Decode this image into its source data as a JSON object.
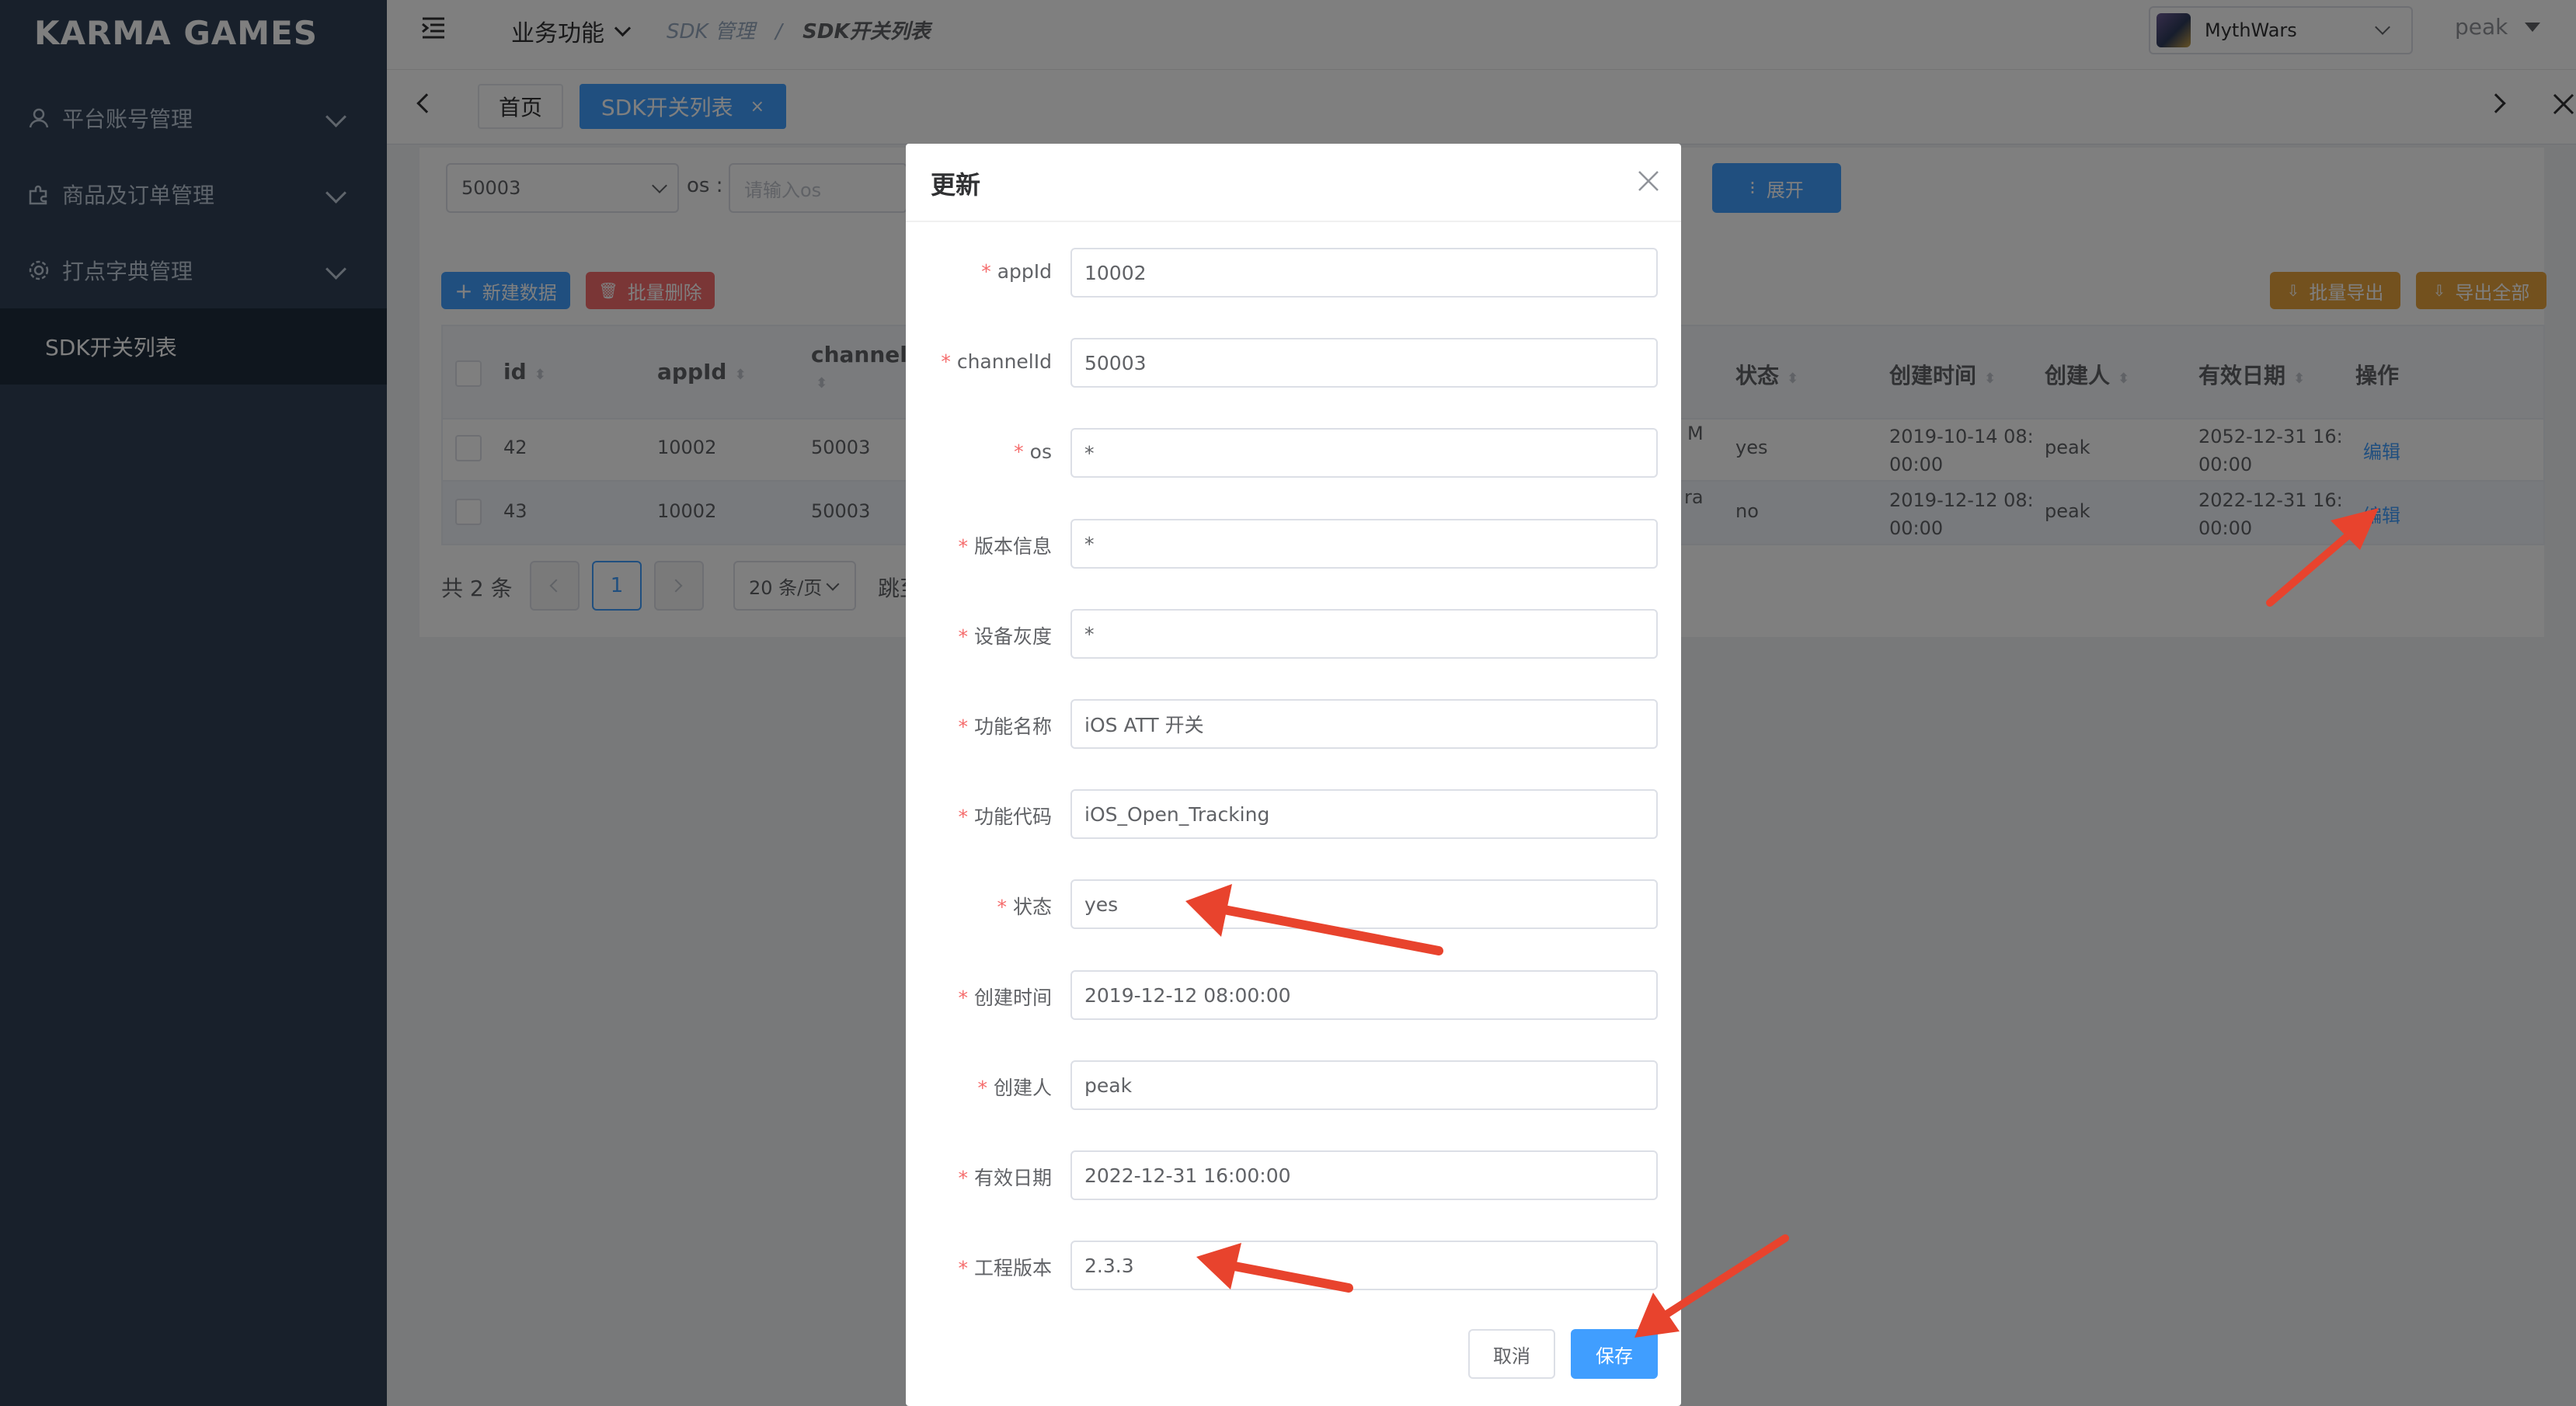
{
  "sidebar": {
    "logo": "KARMA GAMES",
    "items": [
      {
        "label": "平台账号管理",
        "icon": "user-icon"
      },
      {
        "label": "商品及订单管理",
        "icon": "puzzle-icon"
      },
      {
        "label": "打点字典管理",
        "icon": "gear-icon"
      }
    ],
    "active_item": "SDK开关列表"
  },
  "header": {
    "menu": "业务功能",
    "breadcrumb": [
      "SDK 管理",
      "/",
      "SDK开关列表"
    ],
    "project": "MythWars",
    "user": "peak"
  },
  "tabs": [
    {
      "label": "首页",
      "active": false
    },
    {
      "label": "SDK开关列表",
      "active": true,
      "close": "×"
    }
  ],
  "filters": {
    "channel_value": "50003",
    "os_label": "os :",
    "os_placeholder": "请输入os",
    "expand_label": "展开"
  },
  "toolbar": {
    "new": "新建数据",
    "batch_delete": "批量删除",
    "batch_export": "批量导出",
    "export_all": "导出全部"
  },
  "table": {
    "columns_left": [
      "id",
      "appId",
      "channelId"
    ],
    "columns_right": [
      "状态",
      "创建时间",
      "创建人",
      "有效日期",
      "操作"
    ],
    "rows": [
      {
        "id": "42",
        "appId": "10002",
        "channelId": "50003",
        "cut": "M",
        "status": "yes",
        "created_1": "2019-10-14 08:",
        "created_2": "00:00",
        "creator": "peak",
        "valid_1": "2052-12-31 16:",
        "valid_2": "00:00",
        "action": "编辑"
      },
      {
        "id": "43",
        "appId": "10002",
        "channelId": "50003",
        "cut": "ra",
        "status": "no",
        "created_1": "2019-12-12 08:",
        "created_2": "00:00",
        "creator": "peak",
        "valid_1": "2022-12-31 16:",
        "valid_2": "00:00",
        "action": "编辑"
      }
    ]
  },
  "pagination": {
    "total": "共 2 条",
    "page": "1",
    "size": "20 条/页",
    "jump": "跳至"
  },
  "dialog": {
    "title": "更新",
    "fields": [
      {
        "label": "appId",
        "value": "10002"
      },
      {
        "label": "channelId",
        "value": "50003"
      },
      {
        "label": "os",
        "value": "*"
      },
      {
        "label": "版本信息",
        "value": "*"
      },
      {
        "label": "设备灰度",
        "value": "*"
      },
      {
        "label": "功能名称",
        "value": "iOS ATT 开关"
      },
      {
        "label": "功能代码",
        "value": "iOS_Open_Tracking"
      },
      {
        "label": "状态",
        "value": "yes"
      },
      {
        "label": "创建时间",
        "value": "2019-12-12 08:00:00"
      },
      {
        "label": "创建人",
        "value": "peak"
      },
      {
        "label": "有效日期",
        "value": "2022-12-31 16:00:00"
      },
      {
        "label": "工程版本",
        "value": "2.3.3"
      }
    ],
    "required_mark": "*",
    "cancel": "取消",
    "save": "保存"
  },
  "colors": {
    "sidebar": "#304156",
    "primary": "#409eff",
    "danger": "#f56c6c",
    "warning": "#e6a23c",
    "annotation": "#e8432d"
  }
}
